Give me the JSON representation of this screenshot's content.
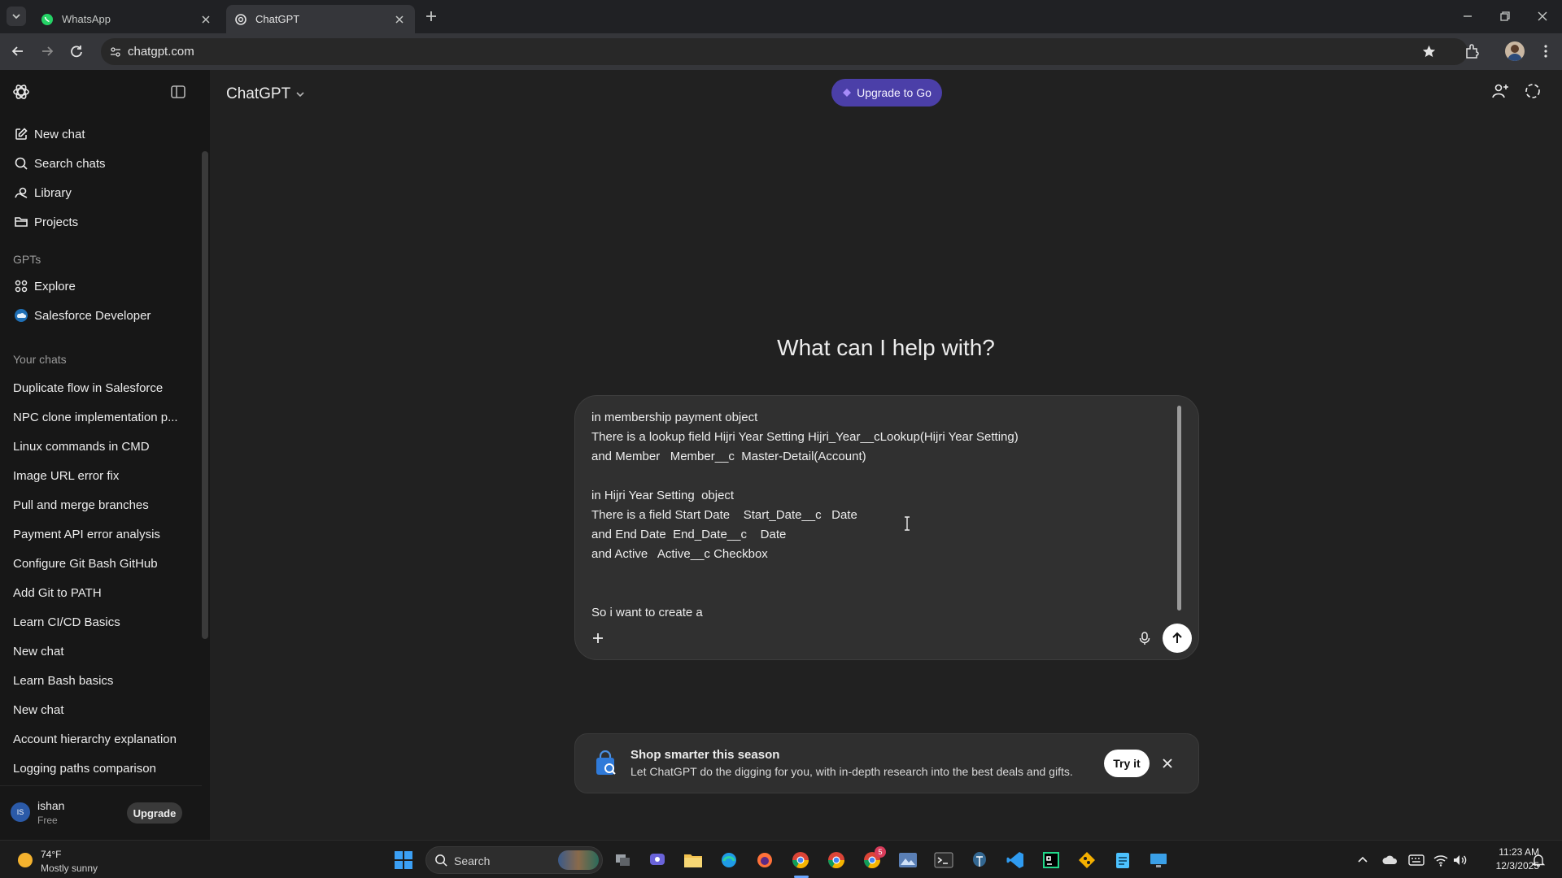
{
  "browser": {
    "tabs": [
      {
        "title": "WhatsApp",
        "active": false
      },
      {
        "title": "ChatGPT",
        "active": true
      }
    ],
    "url": "chatgpt.com"
  },
  "sidebar": {
    "top_items": [
      {
        "label": "New chat",
        "icon": "edit-icon"
      },
      {
        "label": "Search chats",
        "icon": "search-icon"
      },
      {
        "label": "Library",
        "icon": "library-icon"
      },
      {
        "label": "Projects",
        "icon": "folder-icon"
      }
    ],
    "gpts_label": "GPTs",
    "gpts": [
      {
        "label": "Explore",
        "icon": "grid-icon"
      },
      {
        "label": "Salesforce Developer",
        "icon": "salesforce-gpt-icon"
      }
    ],
    "your_chats_label": "Your chats",
    "chats": [
      "Duplicate flow in Salesforce",
      "NPC clone implementation p...",
      "Linux commands in CMD",
      "Image URL error fix",
      "Pull and merge branches",
      "Payment API error analysis",
      "Configure Git Bash GitHub",
      "Add Git to PATH",
      "Learn CI/CD Basics",
      "New chat",
      "Learn Bash basics",
      "New chat",
      "Account hierarchy explanation",
      "Logging paths comparison"
    ],
    "user": {
      "initials": "IS",
      "name": "ishan",
      "plan": "Free",
      "upgrade_label": "Upgrade"
    }
  },
  "header": {
    "model_label": "ChatGPT",
    "upgrade_label": "Upgrade to Go"
  },
  "main": {
    "heading": "What can I help with?",
    "composer_lines": [
      "in membership payment object",
      "There is a lookup field Hijri Year Setting Hijri_Year__cLookup(Hijri Year Setting)",
      "and Member   Member__c  Master-Detail(Account)",
      "",
      "in Hijri Year Setting  object",
      "There is a field Start Date    Start_Date__c   Date",
      "and End Date  End_Date__c    Date",
      "and Active   Active__c Checkbox",
      "",
      "",
      "So i want to create a"
    ]
  },
  "promo": {
    "title": "Shop smarter this season",
    "body": "Let ChatGPT do the digging for you, with in-depth research into the best deals and gifts.",
    "button_label": "Try it"
  },
  "taskbar": {
    "weather_temp": "74°F",
    "weather_desc": "Mostly sunny",
    "search_label": "Search",
    "time": "11:23 AM",
    "date": "12/3/2025",
    "notification_badge": "5"
  },
  "colors": {
    "upgrade_pill": "#4b3fa8",
    "accent_purple": "#a78bfa",
    "background": "#212121",
    "sidebar": "#171717"
  }
}
